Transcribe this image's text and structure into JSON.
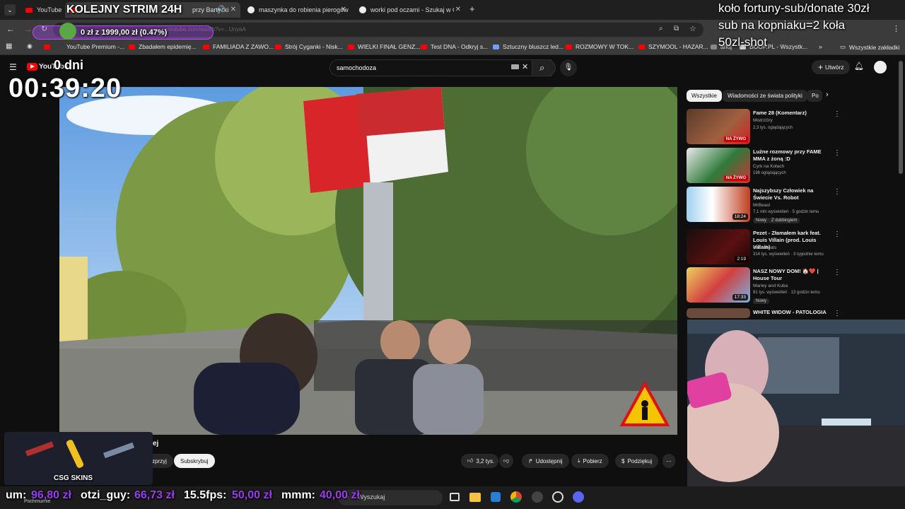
{
  "browser": {
    "tabs": [
      {
        "label": "YouTube",
        "active": false
      },
      {
        "label": "przy Bartycki",
        "active": true
      },
      {
        "label": "maszynka do robienia pierogów",
        "active": false
      },
      {
        "label": "worki pod oczami - Szukaj w Go",
        "active": false
      }
    ],
    "new_tab": "+",
    "address": "youtube.com/watch?v=...UnyaA",
    "bookmarks": [
      "YouTube Premium -...",
      "Zbadałem epidemię...",
      "FAMILIADA Z ZAWO...",
      "Strój Cyganki - Nisk...",
      "WIELKI FINAŁ GENZ...",
      "Test DNA - Odkryj s...",
      "Sztuczny bluszcz led...",
      "ROZMOWY W TOK...",
      "SZYMOOL - HAZAR...",
      "ahoj",
      "BOOP.PL - Wszystk..."
    ],
    "all_bookmarks": "Wszystkie zakładki"
  },
  "youtube": {
    "logo": "YouTube",
    "search_value": "samochodoza",
    "create_label": "Utwórz",
    "chips": [
      "Wszystkie",
      "Wiadomości ze świata polityki",
      "Po"
    ],
    "recommendations": [
      {
        "title": "Fame 28 (Komentarz)",
        "channel": "MistrzGry",
        "meta": "2,3 tys. oglądających",
        "badge": "NA ŻYWO",
        "duration": "",
        "new": ""
      },
      {
        "title": "Luźne rozmowy przy FAME MMA z żoną :D",
        "channel": "Cyrk na Kołach",
        "meta": "198 oglądających",
        "badge": "NA ŻYWO",
        "duration": "",
        "new": ""
      },
      {
        "title": "Najszybszy Człowiek na Świecie Vs. Robot",
        "channel": "MrBeast",
        "meta": "7,1 mln wyświetleń · 5 godzin temu",
        "badge": "",
        "duration": "18:24",
        "new": "Nowy",
        "extra": "Z dubbingiem"
      },
      {
        "title": "Pezet - Złamałem kark feat. Louis Villain (prod. Louis Villain)",
        "channel": "Koka Beats",
        "meta": "314 tys. wyświetleń · 3 tygodnie temu",
        "badge": "",
        "duration": "2:19",
        "new": ""
      },
      {
        "title": "NASZ NOWY DOM! 🏠❤️ | House Tour",
        "channel": "Marley and Kuba",
        "meta": "81 tys. wyświetleń · 13 godzin temu",
        "badge": "",
        "duration": "17:33",
        "new": "Nowy"
      },
      {
        "title": "WHITE WIDOW - PATOLOGIA",
        "channel": "",
        "meta": "",
        "badge": "",
        "duration": "",
        "new": ""
      }
    ],
    "actions": {
      "likes": "3,2 tys.",
      "share": "Udostępnij",
      "download": "Pobierz",
      "thanks": "Podziękuj",
      "subscribe": "Subskrybuj",
      "support": "zprzyj",
      "channel_tail": "ej"
    }
  },
  "overlay": {
    "stream_title": "KOLEJNY STRIM 24H",
    "goal": "0 zł z 1999,00 zł (0.47%)",
    "days": "0 dni",
    "timer": "00:39:20",
    "wheel_line1": "koło fortuny-sub/donate 30zł",
    "wheel_line2": "sub na kopniaku=2 koła",
    "wheel_line3": "50zl-shot",
    "csg_label": "CSG SKINS",
    "bottom_ticker": [
      {
        "name": "um:",
        "amount": "96,80 zł"
      },
      {
        "name": "otzi_guy:",
        "amount": "66,73 zł"
      },
      {
        "name": "15.5fps:",
        "amount": "50,00 zł"
      },
      {
        "name": "mmm:",
        "amount": "40,00 zł"
      }
    ],
    "corner_text": "Pochmurnie"
  },
  "taskbar": {
    "search_placeholder": "Wyszukaj"
  },
  "colors": {
    "youtube_red": "#ff0000",
    "ticker_amount": "#9b3cf0",
    "goal_bar": "#b44dff"
  }
}
